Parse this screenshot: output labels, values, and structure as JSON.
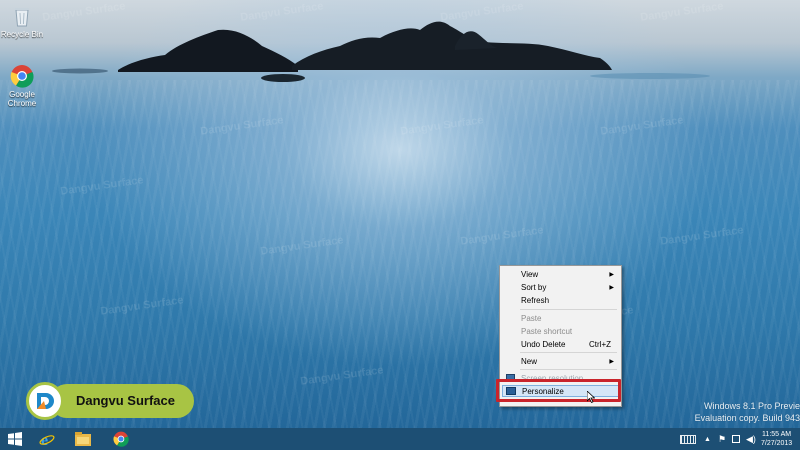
{
  "desktop": {
    "icons": [
      {
        "label": "Recycle Bin",
        "icon": "recycle-bin-icon"
      },
      {
        "label": "Google Chrome",
        "icon": "chrome-icon"
      }
    ],
    "watermark_text": "Dangvu Surface"
  },
  "context_menu": {
    "items": [
      {
        "label": "View",
        "submenu": true,
        "enabled": true
      },
      {
        "label": "Sort by",
        "submenu": true,
        "enabled": true
      },
      {
        "label": "Refresh",
        "enabled": true
      },
      {
        "label": "Paste",
        "enabled": false
      },
      {
        "label": "Paste shortcut",
        "enabled": false
      },
      {
        "label": "Undo Delete",
        "shortcut": "Ctrl+Z",
        "enabled": true
      },
      {
        "label": "New",
        "submenu": true,
        "enabled": true
      },
      {
        "label": "Screen resolution",
        "enabled": true,
        "icon": "screen-resolution-icon"
      },
      {
        "label": "Personalize",
        "enabled": true,
        "icon": "personalize-icon",
        "highlighted": true
      }
    ],
    "highlight_color": "#c9242b"
  },
  "badge": {
    "text": "Dangvu Surface",
    "color": "#a8c444"
  },
  "edition": {
    "line1": "Windows 8.1 Pro Previe",
    "line2": "Evaluation copy. Build 943"
  },
  "taskbar": {
    "pinned": [
      {
        "name": "start",
        "icon": "windows-logo-icon"
      },
      {
        "name": "internet-explorer",
        "icon": "ie-icon"
      },
      {
        "name": "file-explorer",
        "icon": "folder-icon"
      },
      {
        "name": "chrome",
        "icon": "chrome-icon"
      }
    ],
    "tray_icons": [
      "keyboard-icon",
      "chevron-up-icon",
      "flag-icon",
      "network-icon",
      "volume-icon"
    ],
    "clock": {
      "time": "11:55 AM",
      "date": "7/27/2013"
    }
  }
}
